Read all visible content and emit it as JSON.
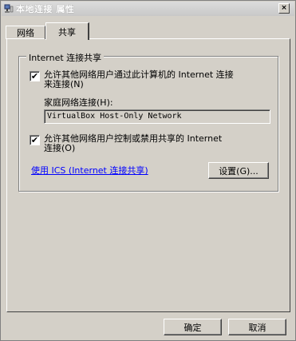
{
  "window": {
    "title": "本地连接 属性",
    "close_glyph": "×"
  },
  "tabs": [
    {
      "label": "网络",
      "active": false
    },
    {
      "label": "共享",
      "active": true
    }
  ],
  "group": {
    "legend": "Internet 连接共享",
    "allow_connect": {
      "checked": true,
      "line1": "允许其他网络用户通过此计算机的 Internet 连接",
      "line2": "来连接(N)"
    },
    "home_network_label": "家庭网络连接(H):",
    "home_network_value": "VirtualBox Host-Only Network",
    "allow_control": {
      "checked": true,
      "line1": "允许其他网络用户控制或禁用共享的 Internet",
      "line2": "连接(O)"
    },
    "ics_link": "使用 ICS (Internet 连接共享)",
    "settings_button": "设置(G)..."
  },
  "footer": {
    "ok_button": "确定",
    "cancel_button": "取消"
  },
  "icons": {
    "title_icon": "network-connection-icon",
    "checkmark": "✔"
  }
}
